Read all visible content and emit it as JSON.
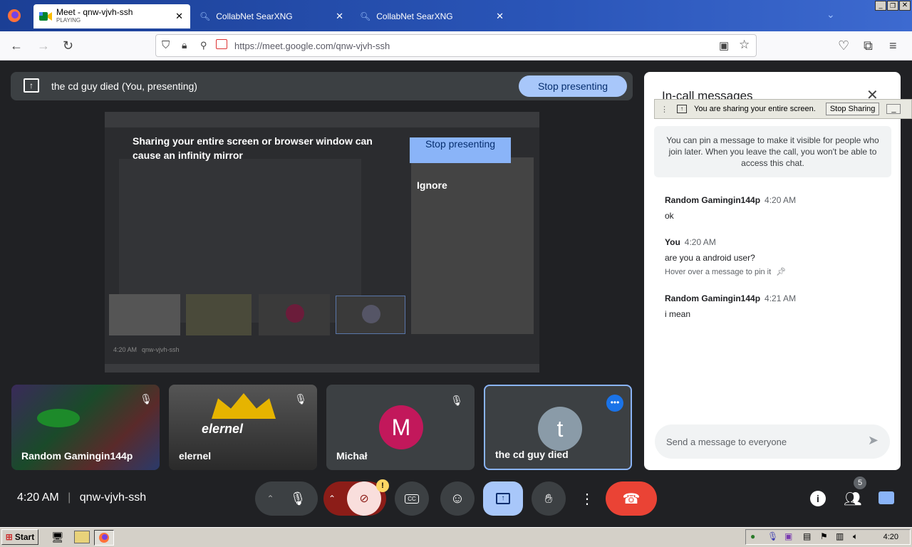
{
  "browser": {
    "tabs": [
      {
        "title": "Meet - qnw-vjvh-ssh",
        "subtitle": "PLAYING"
      },
      {
        "title": "CollabNet SearXNG"
      },
      {
        "title": "CollabNet SearXNG"
      }
    ],
    "url": "https://meet.google.com/qnw-vjvh-ssh"
  },
  "meet": {
    "presenting_label": "the cd guy died (You, presenting)",
    "stop_presenting_label": "Stop presenting",
    "preview": {
      "warning": "Sharing your entire screen or browser window can cause an infinity mirror",
      "stop_label": "Stop presenting",
      "ignore_label": "Ignore",
      "inner_time": "4:20 AM",
      "inner_code": "qnw-vjvh-ssh"
    },
    "tiles": [
      {
        "name": "Random Gamingin144p",
        "muted": true
      },
      {
        "name": "elernel",
        "muted": true,
        "overlay_text": "elernel"
      },
      {
        "name": "Michał",
        "initial": "M",
        "muted": true
      },
      {
        "name": "the cd guy died",
        "initial": "t",
        "muted": false
      }
    ],
    "time": "4:20 AM",
    "meeting_code": "qnw-vjvh-ssh",
    "people_count": "5",
    "alert_badge": "!"
  },
  "chat": {
    "title": "In-call messages",
    "share_notice": "You are sharing your entire screen.",
    "stop_sharing_label": "Stop Sharing",
    "pin_info": "You can pin a message to make it visible for people who join later. When you leave the call, you won't be able to access this chat.",
    "messages": [
      {
        "sender": "Random Gamingin144p",
        "time": "4:20 AM",
        "text": "ok"
      },
      {
        "sender": "You",
        "time": "4:20 AM",
        "text": "are you a android user?",
        "hint": "Hover over a message to pin it"
      },
      {
        "sender": "Random Gamingin144p",
        "time": "4:21 AM",
        "text": "i mean"
      }
    ],
    "input_placeholder": "Send a message to everyone"
  },
  "taskbar": {
    "start_label": "Start",
    "clock": "4:20"
  },
  "colors": {
    "meet_bg": "#202124",
    "accent_blue": "#a8c7fa",
    "end_call": "#ea4335",
    "avatar_m": "#c2185b",
    "avatar_t": "#8a9ba8"
  }
}
